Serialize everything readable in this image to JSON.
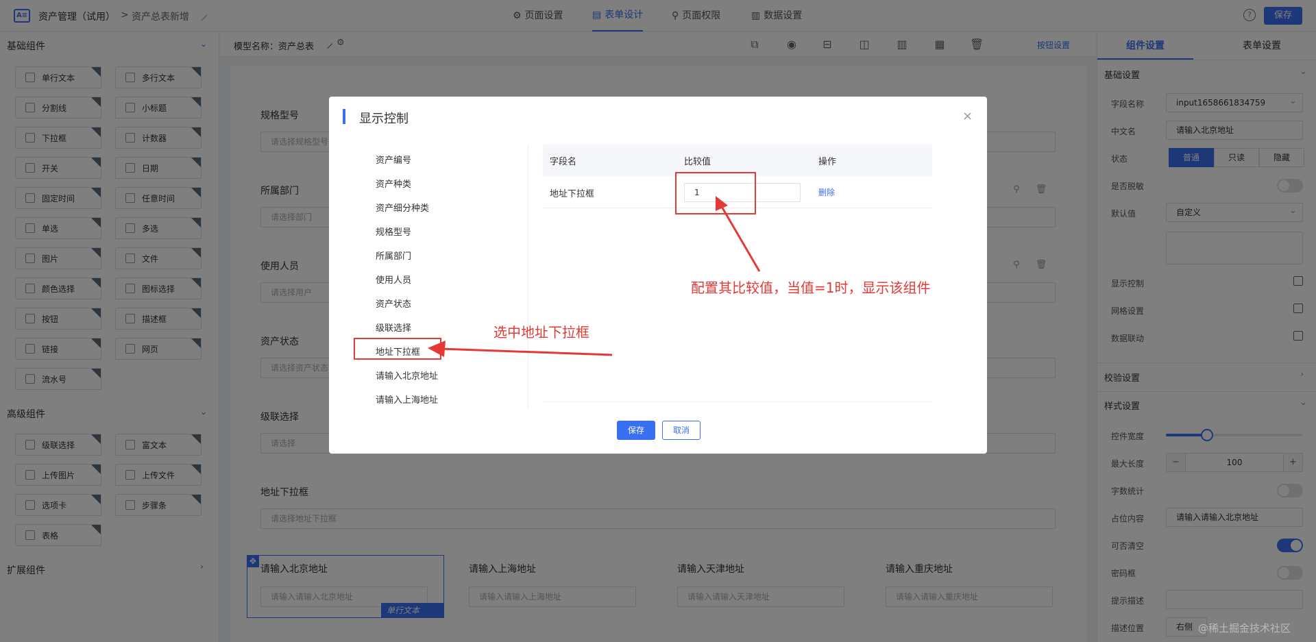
{
  "topbar": {
    "logo": "A≡",
    "app_title": "资产管理（试用）",
    "sep": ">",
    "page_title": "资产总表新增",
    "tabs": [
      {
        "label": "页面设置",
        "icon": "gear-icon"
      },
      {
        "label": "表单设计",
        "icon": "form-icon"
      },
      {
        "label": "页面权限",
        "icon": "lock-icon"
      },
      {
        "label": "数据设置",
        "icon": "chart-icon"
      }
    ],
    "help": "?",
    "save_label": "保存"
  },
  "left": {
    "basic_title": "基础组件",
    "basic": [
      "单行文本",
      "多行文本",
      "分割线",
      "小标题",
      "下拉框",
      "计数器",
      "开关",
      "日期",
      "固定时间",
      "任意时间",
      "单选",
      "多选",
      "图片",
      "文件",
      "颜色选择",
      "图标选择",
      "按钮",
      "描述框",
      "链接",
      "网页",
      "流水号"
    ],
    "advanced_title": "高级组件",
    "advanced": [
      "级联选择",
      "富文本",
      "上传图片",
      "上传文件",
      "选项卡",
      "步骤条",
      "表格"
    ],
    "ext_title": "扩展组件"
  },
  "toolbar": {
    "model_label": "模型名称：资产总表",
    "btn_settings": "按钮设置"
  },
  "canvas": {
    "fields": [
      {
        "label": "规格型号",
        "placeholder": "请选择规格型号"
      },
      {
        "label": "所属部门",
        "placeholder": "请选择部门"
      },
      {
        "label": "使用人员",
        "placeholder": "请选择用户"
      },
      {
        "label": "资产状态",
        "placeholder": "请选择资产状态"
      },
      {
        "label": "级联选择",
        "placeholder": "请选择"
      },
      {
        "label": "地址下拉框",
        "placeholder": "请选择地址下拉框"
      }
    ],
    "row": [
      {
        "label": "请输入北京地址",
        "placeholder": "请输入请输入北京地址"
      },
      {
        "label": "请输入上海地址",
        "placeholder": "请输入请输入上海地址"
      },
      {
        "label": "请输入天津地址",
        "placeholder": "请输入请输入天津地址"
      },
      {
        "label": "请输入重庆地址",
        "placeholder": "请输入请输入重庆地址"
      }
    ],
    "selected_tag": "单行文本"
  },
  "right": {
    "tab_component": "组件设置",
    "tab_form": "表单设置",
    "basic_title": "基础设置",
    "field_name_label": "字段名称",
    "field_name_value": "input1658661834759",
    "cn_name_label": "中文名",
    "cn_name_value": "请输入北京地址",
    "state_label": "状态",
    "state_options": [
      "普通",
      "只读",
      "隐藏"
    ],
    "desens_label": "是否脱敏",
    "default_label": "默认值",
    "default_value": "自定义",
    "display_ctrl_label": "显示控制",
    "grid_label": "网格设置",
    "linkage_label": "数据联动",
    "validate_title": "校验设置",
    "style_title": "样式设置",
    "width_label": "控件宽度",
    "width_value": 0.3,
    "maxlen_label": "最大长度",
    "maxlen_value": "100",
    "minus": "−",
    "plus": "+",
    "count_label": "字数统计",
    "placeholder_label": "占位内容",
    "placeholder_value": "请输入请输入北京地址",
    "clearable_label": "可否清空",
    "password_label": "密码框",
    "hint_label": "提示描述",
    "desc_pos_label": "描述位置",
    "desc_pos_value": "右侧"
  },
  "modal": {
    "title": "显示控制",
    "close": "×",
    "fields": [
      "资产编号",
      "资产种类",
      "资产细分种类",
      "规格型号",
      "所属部门",
      "使用人员",
      "资产状态",
      "级联选择",
      "地址下拉框",
      "请输入北京地址",
      "请输入上海地址"
    ],
    "th_field": "字段名",
    "th_compare": "比较值",
    "th_action": "操作",
    "row_field": "地址下拉框",
    "row_value": "1",
    "row_delete": "删除",
    "save": "保存",
    "cancel": "取消"
  },
  "annotations": {
    "select_note": "选中地址下拉框",
    "config_note": "配置其比较值，当值=1时，显示该组件",
    "accent": "#e53935"
  },
  "watermark": "@稀土掘金技术社区"
}
